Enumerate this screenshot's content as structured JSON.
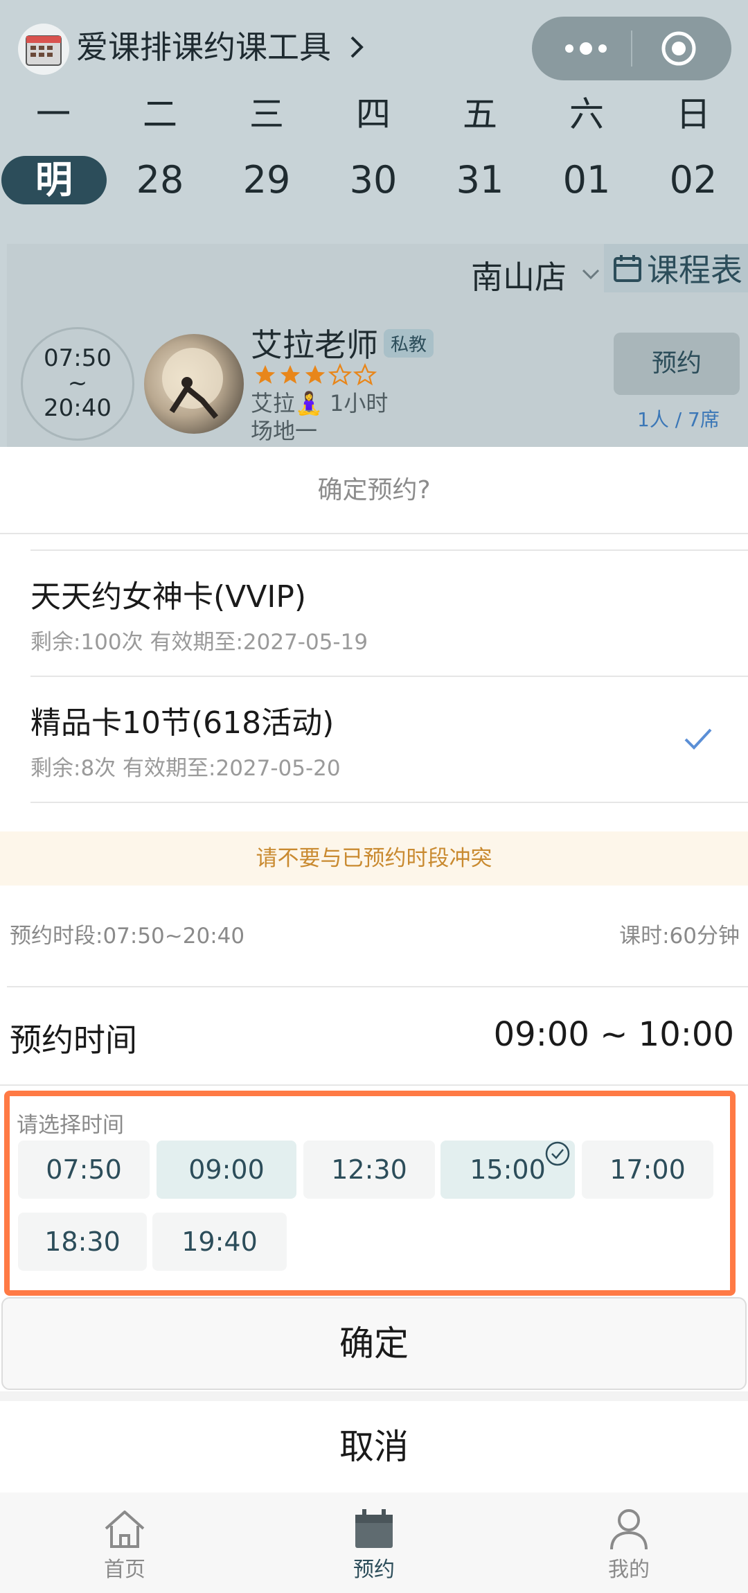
{
  "header": {
    "app_title": "爱课排课约课工具",
    "logo_icon": "calendar-logo-icon",
    "capsule_more_icon": "more-dots-icon",
    "capsule_close_icon": "target-close-icon"
  },
  "calendar": {
    "weekdays": [
      "一",
      "二",
      "三",
      "四",
      "五",
      "六",
      "日"
    ],
    "dates": [
      "明",
      "28",
      "29",
      "30",
      "31",
      "01",
      "02"
    ],
    "selected_index": 0
  },
  "store": {
    "name": "南山店",
    "schedule_label": "课程表"
  },
  "course": {
    "time_start": "07:50",
    "time_sep": "~",
    "time_end": "20:40",
    "teacher_name": "艾拉老师",
    "badge": "私教",
    "rating": 3,
    "rating_max": 5,
    "meta_line1": "艾拉🧘‍♀️ 1小时",
    "meta_line2": "场地一",
    "book_label": "预约",
    "capacity": "1人 / 7席"
  },
  "sheet": {
    "title": "确定预约?",
    "cards": [
      {
        "name": "天天约女神卡(VVIP)",
        "detail": "剩余:100次 有效期至:2027-05-19",
        "selected": false
      },
      {
        "name": "精品卡10节(618活动)",
        "detail": "剩余:8次 有效期至:2027-05-20",
        "selected": true
      }
    ],
    "warning": "请不要与已预约时段冲突",
    "slot_range": "预约时段:07:50~20:40",
    "lesson_duration": "课时:60分钟",
    "booking_time_label": "预约时间",
    "booking_time_value": "09:00 ~ 10:00",
    "picker_hint": "请选择时间",
    "slots": [
      {
        "label": "07:50",
        "state": "normal"
      },
      {
        "label": "09:00",
        "state": "highlight"
      },
      {
        "label": "12:30",
        "state": "normal"
      },
      {
        "label": "15:00",
        "state": "checked"
      },
      {
        "label": "17:00",
        "state": "normal"
      },
      {
        "label": "18:30",
        "state": "normal"
      },
      {
        "label": "19:40",
        "state": "normal"
      }
    ],
    "confirm_label": "确定",
    "cancel_label": "取消"
  },
  "tabbar": {
    "items": [
      {
        "label": "首页",
        "icon": "home-icon",
        "active": false
      },
      {
        "label": "预约",
        "icon": "calendar-icon",
        "active": true
      },
      {
        "label": "我的",
        "icon": "user-icon",
        "active": false
      }
    ]
  },
  "colors": {
    "accent": "#2c4d5a",
    "highlight_border": "#ff7a45",
    "warning_text": "#c98a30",
    "warning_bg": "#fdf6ea",
    "link_blue": "#3b77b7",
    "check_blue": "#5b8fd6",
    "star_orange": "#e8861a"
  }
}
